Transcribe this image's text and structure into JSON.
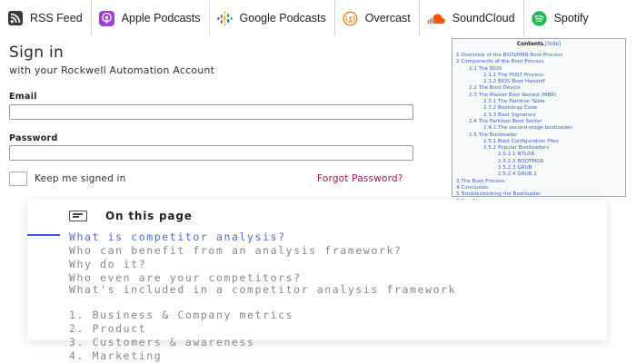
{
  "podcast_bar": {
    "items": [
      {
        "label": "RSS Feed",
        "icon": "rss-icon",
        "color": "#333333"
      },
      {
        "label": "Apple Podcasts",
        "icon": "apple-podcasts-icon",
        "color": "#9b43d8"
      },
      {
        "label": "Google Podcasts",
        "icon": "google-podcasts-icon",
        "color": "#4285f4"
      },
      {
        "label": "Overcast",
        "icon": "overcast-icon",
        "color": "#f58220"
      },
      {
        "label": "SoundCloud",
        "icon": "soundcloud-icon",
        "color": "#ff5500"
      },
      {
        "label": "Spotify",
        "icon": "spotify-icon",
        "color": "#1db954"
      }
    ]
  },
  "signin": {
    "title": "Sign in",
    "subtitle": "with your Rockwell Automation Account",
    "email_label": "Email",
    "email_value": "",
    "password_label": "Password",
    "password_value": "",
    "keep_signed_in_label": "Keep me signed in",
    "forgot_label": "Forgot Password?",
    "accent_color": "#a0175a"
  },
  "toc": {
    "title": "Contents",
    "hide_label": "[hide]",
    "items": [
      {
        "text": "1 Overview of the BIOS/MBR Boot Process",
        "level": 0
      },
      {
        "text": "2 Components of the Boot Process",
        "level": 0
      },
      {
        "text": "2.1  The BIOS",
        "level": 1
      },
      {
        "text": "2.1.1 The POST Process",
        "level": 2
      },
      {
        "text": "2.1.2 BIOS Boot Handoff",
        "level": 2
      },
      {
        "text": "2.2 The Boot Device",
        "level": 1
      },
      {
        "text": "2.3 The Master Boot Record (MBR)",
        "level": 1
      },
      {
        "text": "2.3.1 The Partition Table",
        "level": 2
      },
      {
        "text": "2.3.2 Bootstrap Code",
        "level": 2
      },
      {
        "text": "2.3.3 Boot Signature",
        "level": 2
      },
      {
        "text": "2.4 The Partition Boot Sector",
        "level": 1
      },
      {
        "text": "2.4.1 The second-stage bootloader",
        "level": 2
      },
      {
        "text": "2.5 The Bootloader",
        "level": 1
      },
      {
        "text": "2.5.1 Boot Configuration Files",
        "level": 2
      },
      {
        "text": "2.5.2 Popular Bootloaders",
        "level": 2
      },
      {
        "text": "2.5.2.1 NTLDR",
        "level": 3
      },
      {
        "text": "2.5.2.2 BOOTMGR",
        "level": 3
      },
      {
        "text": "2.5.2.3 GRUB",
        "level": 3
      },
      {
        "text": "2.5.2.4 GRUB 2",
        "level": 3
      },
      {
        "text": "3 The Boot Process",
        "level": 0
      },
      {
        "text": "4 Conclusion",
        "level": 0
      },
      {
        "text": "5 Troubleshooting the Bootloader",
        "level": 0
      },
      {
        "text": "6 See Also",
        "level": 0
      }
    ]
  },
  "on_this_page": {
    "title": "On this page",
    "icon": "document-list-icon",
    "accent_color": "#3b5bd6",
    "items": [
      {
        "text": "What is competitor analysis?",
        "active": true
      },
      {
        "text": "Who can benefit from an analysis framework?",
        "active": false
      },
      {
        "text": "Why do it?",
        "active": false
      },
      {
        "text": "Who even are your competitors?",
        "active": false
      },
      {
        "text": "What's included in a competitor analysis framework",
        "active": false
      },
      {
        "text": "1. Business & Company metrics",
        "active": false
      },
      {
        "text": "2. Product",
        "active": false
      },
      {
        "text": "3. Customers & awareness",
        "active": false
      },
      {
        "text": "4. Marketing",
        "active": false
      }
    ]
  }
}
